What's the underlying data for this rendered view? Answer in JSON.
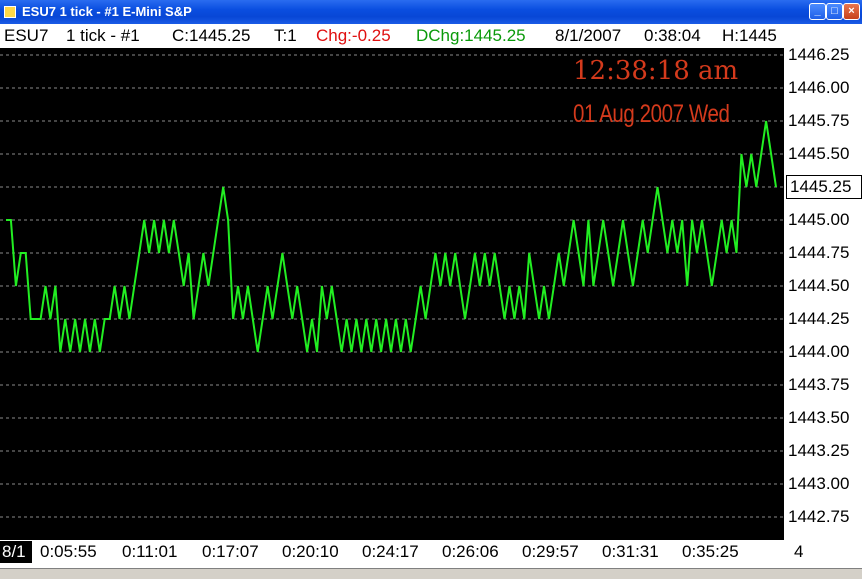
{
  "window": {
    "title": "ESU7  1 tick - #1 E-Mini S&P"
  },
  "info": {
    "symbol": "ESU7",
    "interval": "1 tick - #1",
    "close": "C:1445.25",
    "ticks": "T:1",
    "change": "Chg:-0.25",
    "dchange": "DChg:1445.25",
    "date": "8/1/2007",
    "time": "0:38:04",
    "high": "H:1445"
  },
  "clock": {
    "time": "12:38:18 am",
    "date": "01 Aug 2007 Wed"
  },
  "colors": {
    "line": "#22ee22",
    "change": "#e01010",
    "dchange": "#0a9a0a",
    "clock": "#d43a1c",
    "grid": "#8a8a8a"
  },
  "chart_data": {
    "type": "line",
    "x_tick_labels": [
      "8/1",
      "0:05:55",
      "0:11:01",
      "0:17:07",
      "0:20:10",
      "0:24:17",
      "0:26:06",
      "0:29:57",
      "0:31:31",
      "0:35:25",
      "4"
    ],
    "y_tick_labels": [
      "1446.25",
      "1446.00",
      "1445.75",
      "1445.50",
      "1445.25",
      "1445.00",
      "1444.75",
      "1444.50",
      "1444.25",
      "1444.00",
      "1443.75",
      "1443.50",
      "1443.25",
      "1443.00",
      "1442.75"
    ],
    "current_price": "1445.25",
    "ylim": [
      1442.625,
      1446.375
    ],
    "grid": true,
    "series": [
      {
        "values": [
          1445.0,
          1445.0,
          1444.5,
          1444.75,
          1444.75,
          1444.25,
          1444.25,
          1444.25,
          1444.5,
          1444.25,
          1444.5,
          1444.0,
          1444.25,
          1444.0,
          1444.25,
          1444.0,
          1444.25,
          1444.0,
          1444.25,
          1444.0,
          1444.25,
          1444.25,
          1444.5,
          1444.25,
          1444.5,
          1444.25,
          1444.5,
          1444.75,
          1445.0,
          1444.75,
          1445.0,
          1444.75,
          1445.0,
          1444.75,
          1445.0,
          1444.75,
          1444.5,
          1444.75,
          1444.25,
          1444.5,
          1444.75,
          1444.5,
          1444.75,
          1445.0,
          1445.25,
          1445.0,
          1444.25,
          1444.5,
          1444.25,
          1444.5,
          1444.25,
          1444.0,
          1444.25,
          1444.5,
          1444.25,
          1444.5,
          1444.75,
          1444.5,
          1444.25,
          1444.5,
          1444.25,
          1444.0,
          1444.25,
          1444.0,
          1444.5,
          1444.25,
          1444.5,
          1444.25,
          1444.0,
          1444.25,
          1444.0,
          1444.25,
          1444.0,
          1444.25,
          1444.0,
          1444.25,
          1444.0,
          1444.25,
          1444.0,
          1444.25,
          1444.0,
          1444.25,
          1444.0,
          1444.25,
          1444.5,
          1444.25,
          1444.5,
          1444.75,
          1444.5,
          1444.75,
          1444.5,
          1444.75,
          1444.5,
          1444.25,
          1444.5,
          1444.75,
          1444.5,
          1444.75,
          1444.5,
          1444.75,
          1444.5,
          1444.25,
          1444.5,
          1444.25,
          1444.5,
          1444.25,
          1444.75,
          1444.5,
          1444.25,
          1444.5,
          1444.25,
          1444.5,
          1444.75,
          1444.5,
          1444.75,
          1445.0,
          1444.75,
          1444.5,
          1445.0,
          1444.5,
          1444.75,
          1445.0,
          1444.75,
          1444.5,
          1444.75,
          1445.0,
          1444.75,
          1444.5,
          1444.75,
          1445.0,
          1444.75,
          1445.0,
          1445.25,
          1445.0,
          1444.75,
          1445.0,
          1444.75,
          1445.0,
          1444.5,
          1445.0,
          1444.75,
          1445.0,
          1444.75,
          1444.5,
          1444.75,
          1445.0,
          1444.75,
          1445.0,
          1444.75,
          1445.5,
          1445.25,
          1445.5,
          1445.25,
          1445.5,
          1445.75,
          1445.5,
          1445.25
        ]
      }
    ]
  }
}
